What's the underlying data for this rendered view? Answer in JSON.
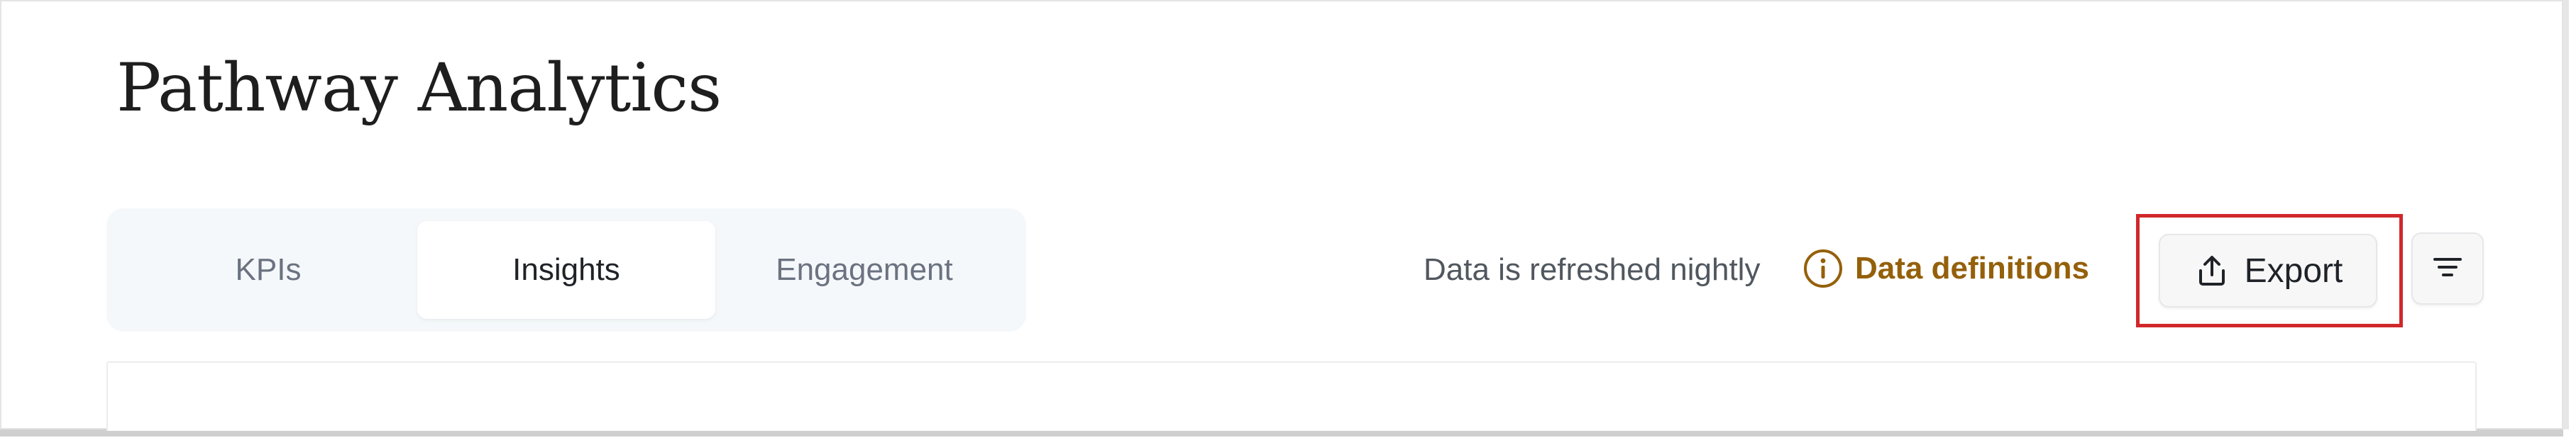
{
  "header": {
    "title": "Pathway Analytics"
  },
  "tabs": [
    {
      "label": "KPIs",
      "active": false
    },
    {
      "label": "Insights",
      "active": true
    },
    {
      "label": "Engagement",
      "active": false
    }
  ],
  "toolbar": {
    "refresh_note": "Data is refreshed nightly",
    "definitions_label": "Data definitions",
    "definitions_icon": "info-circle-icon",
    "export_label": "Export",
    "export_icon": "upload-share-icon",
    "filter_icon": "filter-lines-icon"
  },
  "colors": {
    "accent_link": "#94600a",
    "highlight_border": "#d0282a",
    "tab_bar_bg": "#f5f8fb"
  }
}
